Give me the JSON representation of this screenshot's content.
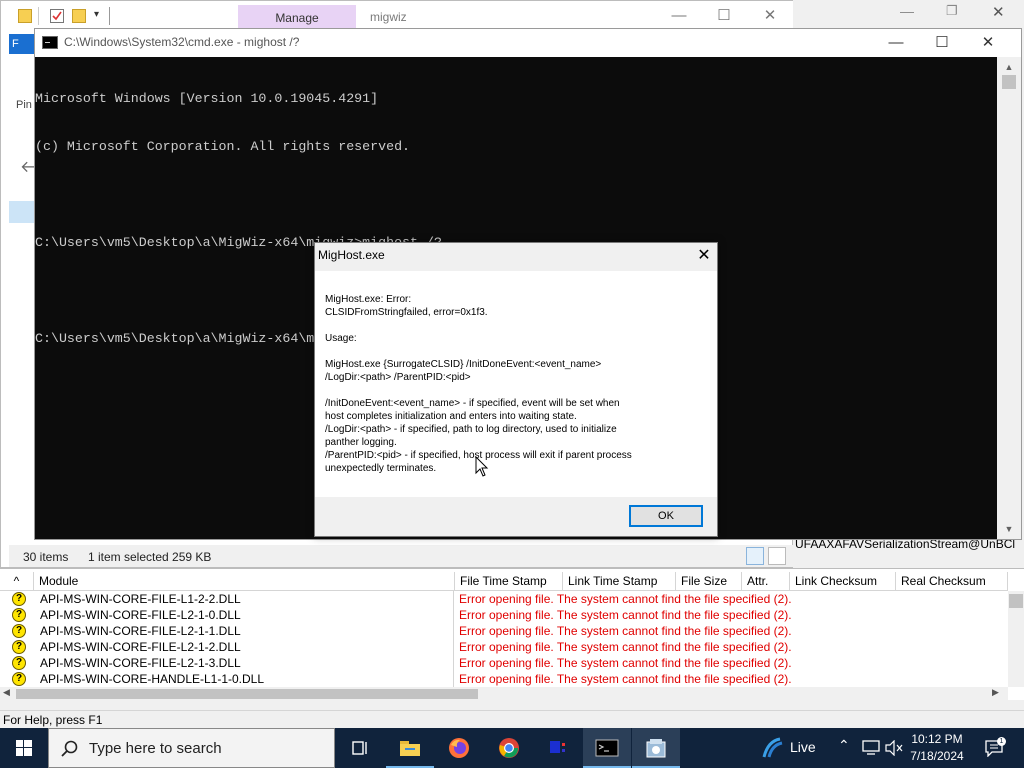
{
  "explorer": {
    "manage_tab": "Manage",
    "title": "migwiz",
    "file_tab": "F",
    "pin_label": "Pin",
    "status": {
      "items_count": "30 items",
      "items_selected": "1 item selected  259 KB"
    }
  },
  "background": {
    "serialization_text": "UFAAXAFAVSerializationStream@UnBCl"
  },
  "cmd": {
    "title": "C:\\Windows\\System32\\cmd.exe - mighost  /?",
    "lines": [
      "Microsoft Windows [Version 10.0.19045.4291]",
      "(c) Microsoft Corporation. All rights reserved.",
      "",
      "C:\\Users\\vm5\\Desktop\\a\\MigWiz-x64\\migwiz>mighost /?",
      "",
      "C:\\Users\\vm5\\Desktop\\a\\MigWiz-x64\\migwiz>mighost /?"
    ]
  },
  "dialog": {
    "title": "MigHost.exe",
    "error_line1": "MigHost.exe: Error:",
    "error_line2": "CLSIDFromStringfailed, error=0x1f3.",
    "usage_label": "Usage:",
    "usage_line1": "MigHost.exe {SurrogateCLSID} /InitDoneEvent:<event_name>",
    "usage_line2": "/LogDir:<path> /ParentPID:<pid>",
    "opt1_line1": "/InitDoneEvent:<event_name> - if specified, event will be set when",
    "opt1_line2": "host completes initialization and enters into waiting state.",
    "opt2_line1": "/LogDir:<path> - if specified, path to log directory, used to initialize",
    "opt2_line2": "panther logging.",
    "opt3_line1": "/ParentPID:<pid> - if specified, host process will exit if parent process",
    "opt3_line2": "unexpectedly terminates.",
    "ok_label": "OK"
  },
  "dependency_table": {
    "columns": [
      "^",
      "Module",
      "File Time Stamp",
      "Link Time Stamp",
      "File Size",
      "Attr.",
      "Link Checksum",
      "Real Checksum"
    ],
    "rows": [
      {
        "module": "API-MS-WIN-CORE-FILE-L1-2-2.DLL",
        "error": "Error opening file. The system cannot find the file specified (2)."
      },
      {
        "module": "API-MS-WIN-CORE-FILE-L2-1-0.DLL",
        "error": "Error opening file. The system cannot find the file specified (2)."
      },
      {
        "module": "API-MS-WIN-CORE-FILE-L2-1-1.DLL",
        "error": "Error opening file. The system cannot find the file specified (2)."
      },
      {
        "module": "API-MS-WIN-CORE-FILE-L2-1-2.DLL",
        "error": "Error opening file. The system cannot find the file specified (2)."
      },
      {
        "module": "API-MS-WIN-CORE-FILE-L2-1-3.DLL",
        "error": "Error opening file. The system cannot find the file specified (2)."
      },
      {
        "module": "API-MS-WIN-CORE-HANDLE-L1-1-0.DLL",
        "error": "Error opening file. The system cannot find the file specified (2)."
      }
    ]
  },
  "status_bar": "For Help, press F1",
  "taskbar": {
    "search_placeholder": "Type here to search",
    "live_label": "Live",
    "time": "10:12 PM",
    "date": "7/18/2024",
    "apps": [
      "task-view-icon",
      "file-explorer-icon",
      "firefox-icon",
      "chrome-icon",
      "app-icon",
      "cmd-icon",
      "dependency-walker-icon"
    ]
  },
  "colors": {
    "error_text": "#e00000",
    "taskbar": "#10233c",
    "accent_blue": "#0078d7",
    "manage_tab": "#e8d3f5",
    "console_bg": "#0c0c0c"
  }
}
